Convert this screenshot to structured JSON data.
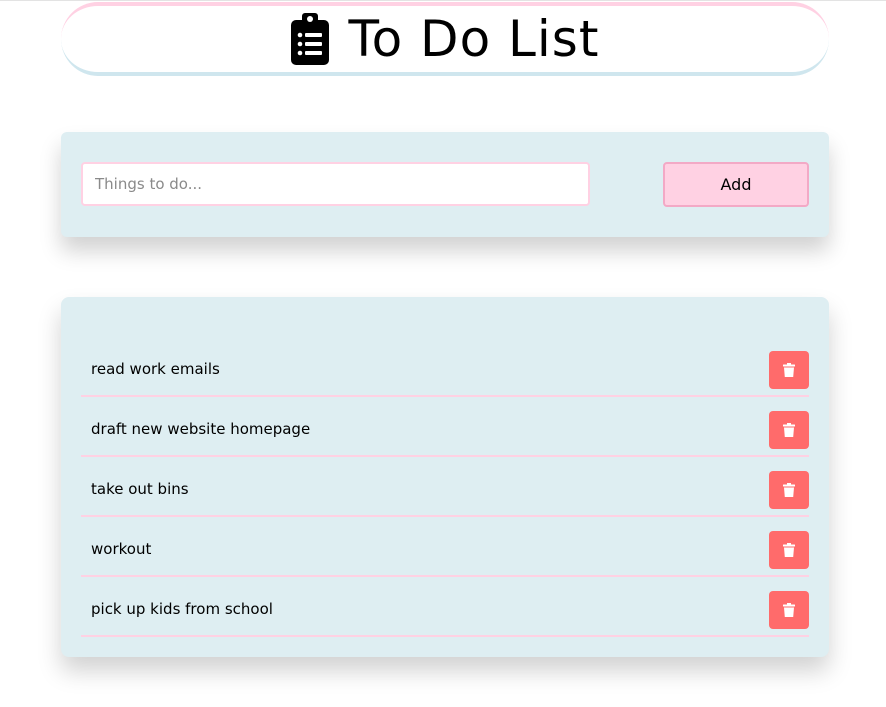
{
  "header": {
    "title": "To Do List",
    "icon": "clipboard-list-icon"
  },
  "form": {
    "input_placeholder": "Things to do...",
    "input_value": "",
    "add_label": "Add"
  },
  "tasks": [
    {
      "text": "read work emails",
      "delete_icon": "trash-icon"
    },
    {
      "text": "draft new website homepage",
      "delete_icon": "trash-icon"
    },
    {
      "text": "take out bins",
      "delete_icon": "trash-icon"
    },
    {
      "text": "workout",
      "delete_icon": "trash-icon"
    },
    {
      "text": "pick up kids from school",
      "delete_icon": "trash-icon"
    }
  ],
  "colors": {
    "card_background": "#deeef2",
    "accent_pink": "#ffd1e3",
    "delete_red": "#ff6b6b"
  }
}
